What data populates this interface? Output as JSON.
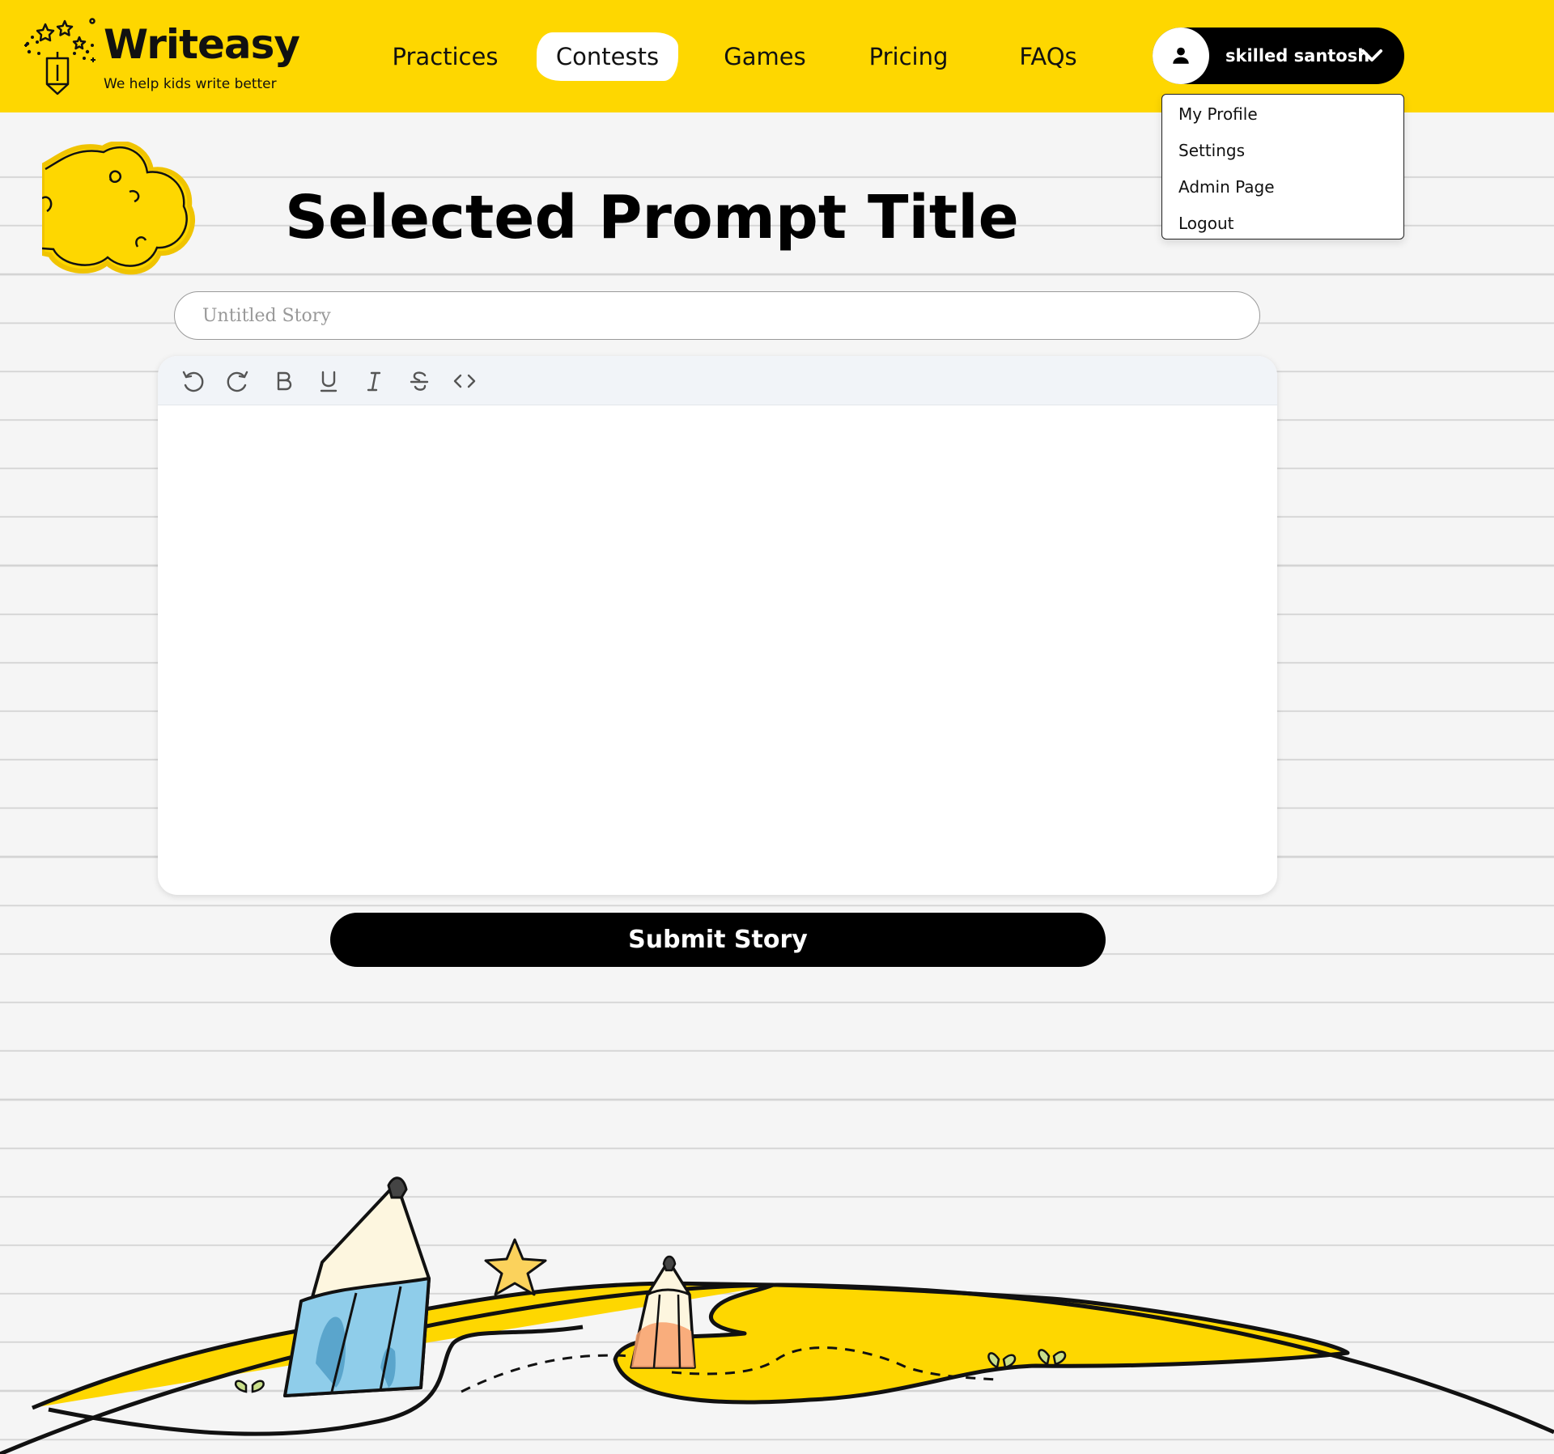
{
  "brand": {
    "name": "Writeasy",
    "tagline": "We help kids write better"
  },
  "nav": {
    "items": [
      {
        "label": "Practices",
        "active": false
      },
      {
        "label": "Contests",
        "active": true
      },
      {
        "label": "Games",
        "active": false
      },
      {
        "label": "Pricing",
        "active": false
      },
      {
        "label": "FAQs",
        "active": false
      }
    ]
  },
  "user": {
    "name": "skilled santosh",
    "avatar_icon": "user-icon",
    "menu_icon": "chevron-down-icon"
  },
  "user_menu": {
    "items": [
      "My Profile",
      "Settings",
      "Admin Page",
      "Logout"
    ]
  },
  "prompt": {
    "title": "Selected Prompt Title"
  },
  "story": {
    "title_value": "",
    "title_placeholder": "Untitled Story",
    "body": ""
  },
  "toolbar": {
    "buttons": [
      "undo-icon",
      "redo-icon",
      "bold-icon",
      "underline-icon",
      "italic-icon",
      "strikethrough-icon",
      "code-icon"
    ]
  },
  "actions": {
    "submit_label": "Submit Story"
  },
  "colors": {
    "brand_yellow": "#fed700",
    "background": "#f5f5f5",
    "button_black": "#000000"
  }
}
